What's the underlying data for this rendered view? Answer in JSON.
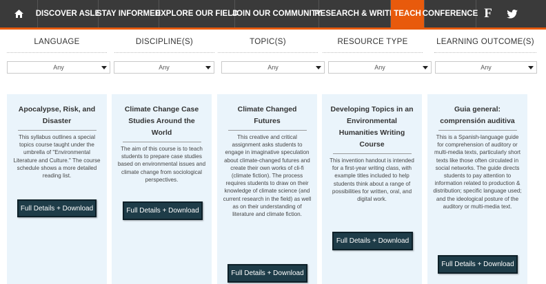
{
  "nav": {
    "items": [
      {
        "label": "DISCOVER ASLE"
      },
      {
        "label": "STAY INFORMED"
      },
      {
        "label": "EXPLORE OUR FIELD"
      },
      {
        "label": "JOIN OUR COMMUNITY"
      },
      {
        "label": "RESEARCH & WRITE"
      },
      {
        "label": "TEACH",
        "active": true
      },
      {
        "label": "CONFERENCE"
      }
    ],
    "social": {
      "facebook": "f"
    }
  },
  "filters": [
    {
      "label": "LANGUAGE",
      "value": "Any"
    },
    {
      "label": "DISCIPLINE(S)",
      "value": "Any"
    },
    {
      "label": "TOPIC(S)",
      "value": "Any"
    },
    {
      "label": "RESOURCE TYPE",
      "value": "Any"
    },
    {
      "label": "LEARNING OUTCOME(S)",
      "value": "Any"
    }
  ],
  "cards": [
    {
      "title": "Apocalypse, Risk, and Disaster",
      "description": "This syllabus outlines a special topics course taught under the umbrella of \"Environmental Literature and Culture.\" The course schedule shows a more detailed reading list.",
      "button": "Full Details + Download"
    },
    {
      "title": "Climate Change Case Studies Around the World",
      "description": "The aim of this course is to teach students to prepare case studies based on environmental issues and climate change from sociological perspectives.",
      "button": "Full Details + Download"
    },
    {
      "title": "Climate Changed Futures",
      "description": "This creative and critical assignment asks students to engage in imaginative speculation about climate-changed futures and create their own works of cli-fi (climate fiction). The process requires students to draw on their knowledge of climate science (and current research in the field) as well as on their understanding of literature and climate fiction.",
      "button": "Full Details + Download"
    },
    {
      "title": "Developing Topics in an Environmental Humanities Writing Course",
      "description": "This invention handout is intended for a first-year writing class, with example titles included to help students think about a range of possibilities for written, oral, and digital work.",
      "button": "Full Details + Download"
    },
    {
      "title": "Guia general: comprensión auditiva",
      "description": "This is a Spanish-language guide for comprehension of auditory or multi-media texts, particularly short texts like those often circulated in social networks. The guide directs students to pay attention to information related to production & distribution; specific language used; and the ideological posture of the auditory or multi-media text.",
      "button": "Full Details + Download"
    }
  ]
}
